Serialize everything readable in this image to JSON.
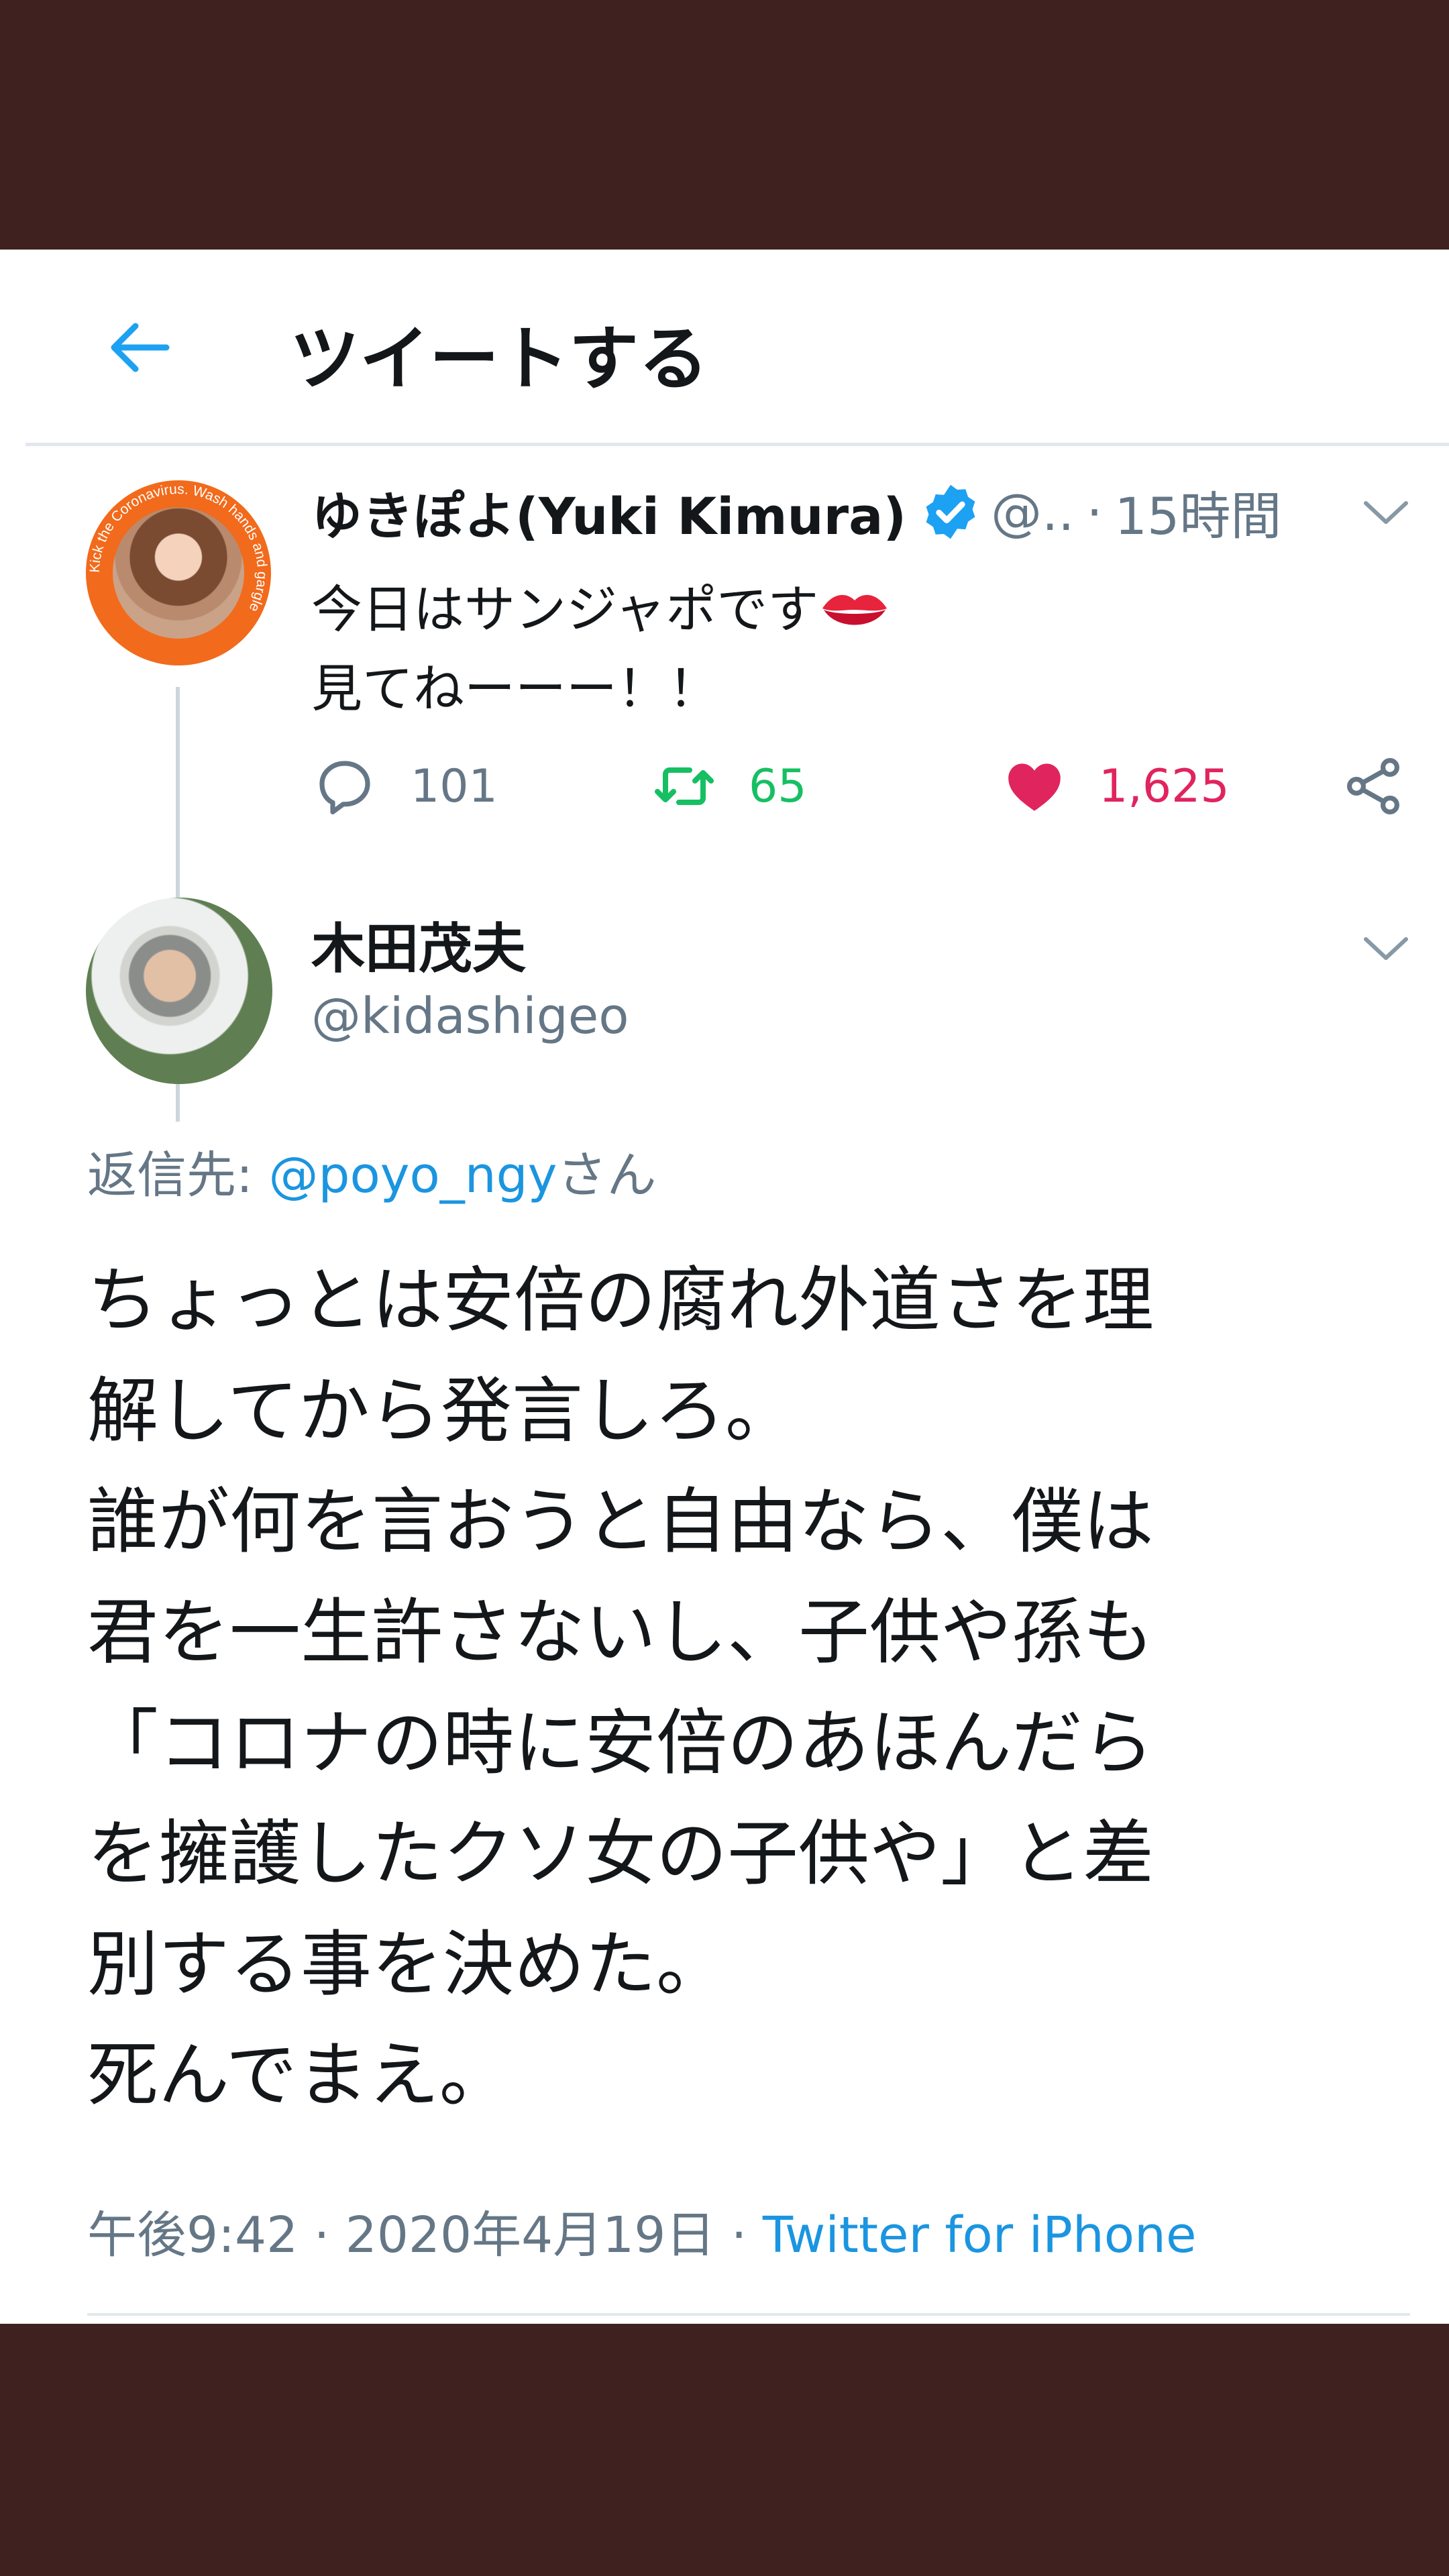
{
  "header": {
    "title": "ツイートする"
  },
  "parent_tweet": {
    "display_name": "ゆきぽよ(Yuki Kimura)",
    "handle_truncated": "@..",
    "separator": "·",
    "time_ago": "15時間",
    "avatar_ring_text": "Kick the Coronavirus. Wash hands and gargle",
    "text_lines": [
      "今日はサンジャポです",
      "見てねーーー！！"
    ],
    "reply_count": "101",
    "retweet_count": "65",
    "like_count": "1,625"
  },
  "main_tweet": {
    "display_name": "木田茂夫",
    "handle": "@kidashigeo",
    "reply_prefix": "返信先: ",
    "reply_mention": "@poyo_ngy",
    "reply_suffix": "さん",
    "text_lines": [
      "ちょっとは安倍の腐れ外道さを理",
      "解してから発言しろ。",
      "誰が何を言おうと自由なら、僕は",
      "君を一生許さないし、子供や孫も",
      "「コロナの時に安倍のあほんだら",
      "を擁護したクソ女の子供や」と差",
      "別する事を決めた。",
      "死んでまえ。"
    ],
    "timestamp": "午後9:42 · 2020年4月19日 · ",
    "source": "Twitter for iPhone"
  },
  "colors": {
    "background": "#3f2220",
    "accent": "#1da1f2",
    "retweet": "#17bf63",
    "like": "#e0245e",
    "muted": "#657786"
  },
  "icons": [
    "back-arrow-icon",
    "verified-icon",
    "chevron-down-icon",
    "kiss-icon",
    "reply-icon",
    "retweet-icon",
    "heart-icon",
    "share-icon"
  ]
}
